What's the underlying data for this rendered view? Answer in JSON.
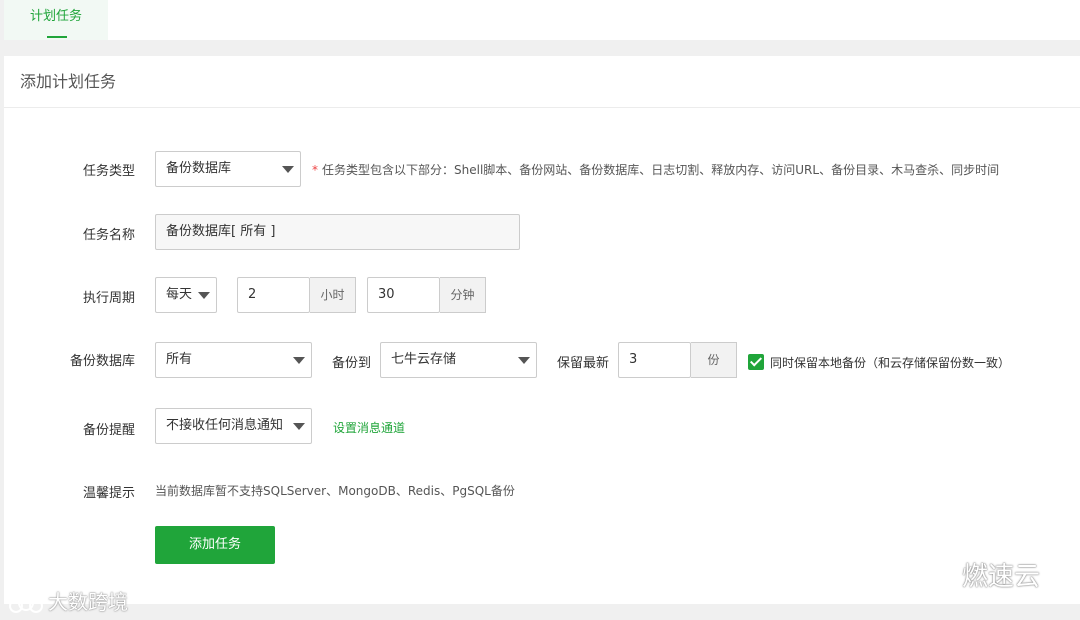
{
  "tabs": [
    {
      "label": "计划任务"
    }
  ],
  "panel": {
    "title": "添加计划任务"
  },
  "form": {
    "task_type": {
      "label": "任务类型",
      "value": "备份数据库",
      "hint": "任务类型包含以下部分：Shell脚本、备份网站、备份数据库、日志切割、释放内存、访问URL、备份目录、木马查杀、同步时间",
      "required_mark": "*"
    },
    "task_name": {
      "label": "任务名称",
      "value": "备份数据库[ 所有 ]"
    },
    "period": {
      "label": "执行周期",
      "frequency": "每天",
      "hour": "2",
      "hour_unit": "小时",
      "minute": "30",
      "minute_unit": "分钟"
    },
    "backup_db": {
      "label": "备份数据库",
      "value": "所有",
      "target_label": "备份到",
      "target_value": "七牛云存储",
      "keep_label": "保留最新",
      "keep_value": "3",
      "keep_unit": "份",
      "keep_local_checked": true,
      "keep_local_label": "同时保留本地备份（和云存储保留份数一致）"
    },
    "notify": {
      "label": "备份提醒",
      "value": "不接收任何消息通知",
      "link": "设置消息通道"
    },
    "tip": {
      "label": "温馨提示",
      "text": "当前数据库暂不支持SQLServer、MongoDB、Redis、PgSQL备份"
    },
    "submit_label": "添加任务"
  },
  "watermarks": {
    "left": "大数跨境",
    "right": "燃速云"
  },
  "colors": {
    "accent": "#20a53a",
    "required": "#e44444"
  }
}
